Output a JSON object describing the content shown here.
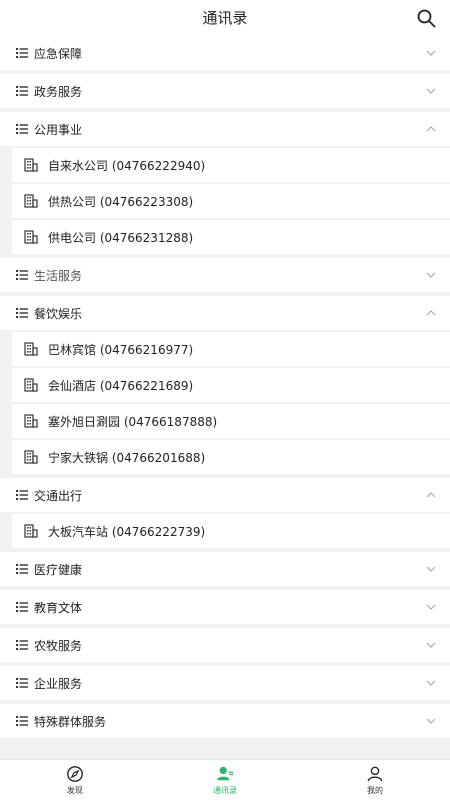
{
  "header": {
    "title": "通讯录"
  },
  "categories": [
    {
      "label": "应急保障",
      "expanded": false
    },
    {
      "label": "政务服务",
      "expanded": false
    },
    {
      "label": "公用事业",
      "expanded": true,
      "items": [
        "自来水公司 (04766222940)",
        "供热公司 (04766223308)",
        "供电公司 (04766231288)"
      ]
    },
    {
      "label": "生活服务",
      "expanded": false
    },
    {
      "label": "餐饮娱乐",
      "expanded": true,
      "items": [
        "巴林宾馆 (04766216977)",
        "会仙酒店 (04766221689)",
        "塞外旭日涮园 (04766187888)",
        "宁家大铁锅 (04766201688)"
      ]
    },
    {
      "label": "交通出行",
      "expanded": true,
      "items": [
        "大板汽车站 (04766222739)"
      ]
    },
    {
      "label": "医疗健康",
      "expanded": false
    },
    {
      "label": "教育文体",
      "expanded": false
    },
    {
      "label": "农牧服务",
      "expanded": false
    },
    {
      "label": "企业服务",
      "expanded": false
    },
    {
      "label": "特殊群体服务",
      "expanded": false
    }
  ],
  "tabbar": {
    "tabs": [
      {
        "label": "发现",
        "icon": "compass-icon"
      },
      {
        "label": "通讯录",
        "icon": "contacts-icon",
        "active": true
      },
      {
        "label": "我的",
        "icon": "person-icon"
      }
    ]
  },
  "colors": {
    "accent": "#2fb36b",
    "background": "#f1f1f1"
  }
}
